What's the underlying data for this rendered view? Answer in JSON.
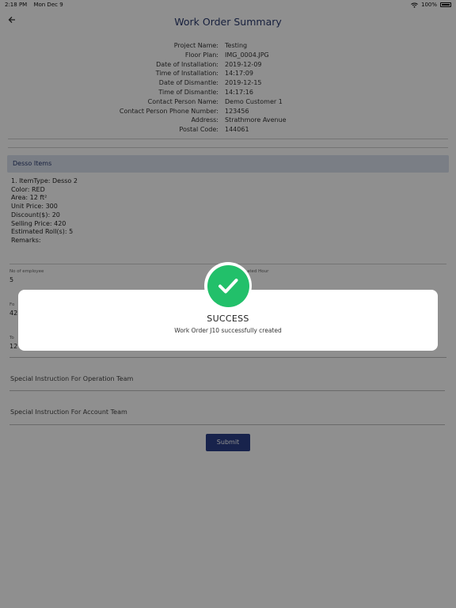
{
  "status_bar": {
    "time": "2:18 PM",
    "date": "Mon Dec 9",
    "battery": "100%"
  },
  "header": {
    "title": "Work Order Summary"
  },
  "info": [
    {
      "label": "Project Name:",
      "value": "Testing"
    },
    {
      "label": "Floor Plan:",
      "value": "IMG_0004.JPG"
    },
    {
      "label": "Date of Installation:",
      "value": "2019-12-09"
    },
    {
      "label": "Time of Installation:",
      "value": "14:17:09"
    },
    {
      "label": "Date of Dismantle:",
      "value": "2019-12-15"
    },
    {
      "label": "Time of Dismantle:",
      "value": "14:17:16"
    },
    {
      "label": "Contact Person Name:",
      "value": "Demo Customer 1"
    },
    {
      "label": "Contact Person Phone Number:",
      "value": "123456"
    },
    {
      "label": "Address:",
      "value": "Strathmore Avenue"
    },
    {
      "label": "Postal Code:",
      "value": "144061"
    }
  ],
  "section": {
    "title": "Desso Items"
  },
  "items": [
    "1. ItemType: Desso 2",
    "Color: RED",
    "Area: 12 ft²",
    "Unit Price: 300",
    "Discount($): 20",
    "Selling Price: 420",
    "Estimated Roll(s): 5",
    "Remarks:"
  ],
  "fields": {
    "employees_label": "No of employee",
    "employees_value": "5",
    "hour_label": "ated Hour",
    "f2_label": "Fo",
    "f2_value": "42",
    "f3_label": "To",
    "f3_value": "12"
  },
  "instructions": {
    "operation": "Special Instruction For Operation Team",
    "account": "Special Instruction For Account Team"
  },
  "submit_label": "Submit",
  "dialog": {
    "title": "SUCCESS",
    "message": "Work Order J10 successfully created"
  }
}
